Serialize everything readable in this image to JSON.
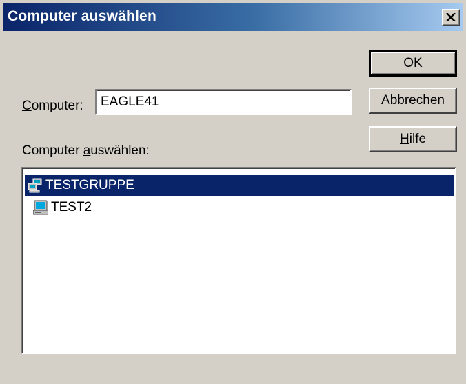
{
  "window": {
    "title": "Computer auswählen",
    "close_glyph": "✕"
  },
  "buttons": {
    "ok": "OK",
    "cancel": "Abbrechen",
    "help_accel": "H",
    "help_rest": "ilfe"
  },
  "computer_field": {
    "label_accel": "C",
    "label_rest": "omputer:",
    "value": "EAGLE41"
  },
  "select_label": {
    "prefix": "Computer ",
    "accel": "a",
    "rest": "uswählen:"
  },
  "tree": {
    "items": [
      {
        "label": "TESTGRUPPE",
        "icon": "workgroup-icon",
        "selected": true
      },
      {
        "label": "TEST2",
        "icon": "computer-icon",
        "selected": false
      }
    ]
  },
  "colors": {
    "face": "#d4d0c8",
    "title_start": "#0a246a",
    "title_end": "#a6caf0",
    "selection": "#0a246a"
  }
}
